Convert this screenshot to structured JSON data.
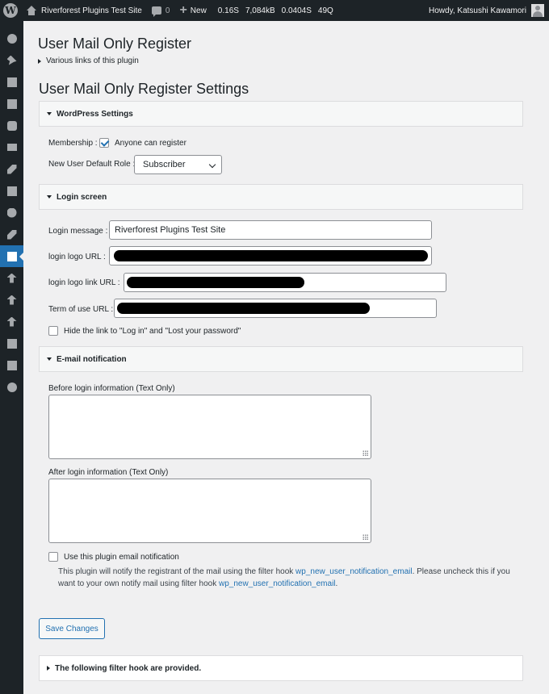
{
  "adminbar": {
    "site_name": "Riverforest Plugins Test Site",
    "comments_count": "0",
    "new_label": "New",
    "stats": [
      "0.16S",
      "7,084kB",
      "0.0404S",
      "49Q"
    ],
    "howdy": "Howdy, Katsushi Kawamori"
  },
  "sidebar": {
    "icons": [
      "dashboard-icon",
      "pin-icon",
      "media-icon",
      "pages-icon",
      "comments-icon",
      "mail-icon",
      "appearance-icon",
      "plugins-icon",
      "users-icon",
      "tools-icon",
      "settings-icon",
      "upload-icon",
      "upload-icon",
      "upload-icon",
      "media-icon",
      "calendar-icon",
      "play-icon"
    ],
    "active_index": 10
  },
  "page": {
    "title": "User Mail Only Register",
    "links_toggle": "Various links of this plugin",
    "settings_title": "User Mail Only Register Settings"
  },
  "wp_settings": {
    "heading": "WordPress Settings",
    "membership_label": "Membership :",
    "anyone_can_register": "Anyone can register",
    "anyone_checked": true,
    "role_label": "New User Default Role :",
    "role_value": "Subscriber"
  },
  "login_screen": {
    "heading": "Login screen",
    "message_label": "Login message :",
    "message_value": "Riverforest Plugins Test Site",
    "logo_url_label": "login logo URL :",
    "logo_link_label": "login logo link URL :",
    "terms_label": "Term of use URL :",
    "hide_links_label": "Hide the link to \"Log in\" and \"Lost your password\""
  },
  "email": {
    "heading": "E-mail notification",
    "before_label": "Before login information (Text Only)",
    "after_label": "After login information (Text Only)",
    "use_plugin_label": "Use this plugin email notification",
    "desc_part1": "This plugin will notify the registrant of the mail using the filter hook ",
    "hook1": "wp_new_user_notification_email",
    "desc_part2": ". Please uncheck this if you want to your own notify mail using filter hook ",
    "hook2": "wp_new_user_notification_email",
    "desc_part3": "."
  },
  "save_button": "Save Changes",
  "filter_hooks": {
    "heading": "The following filter hook are provided."
  },
  "colors": {
    "accent": "#2271b1",
    "adminbar": "#1d2327",
    "background": "#f0f0f1"
  }
}
